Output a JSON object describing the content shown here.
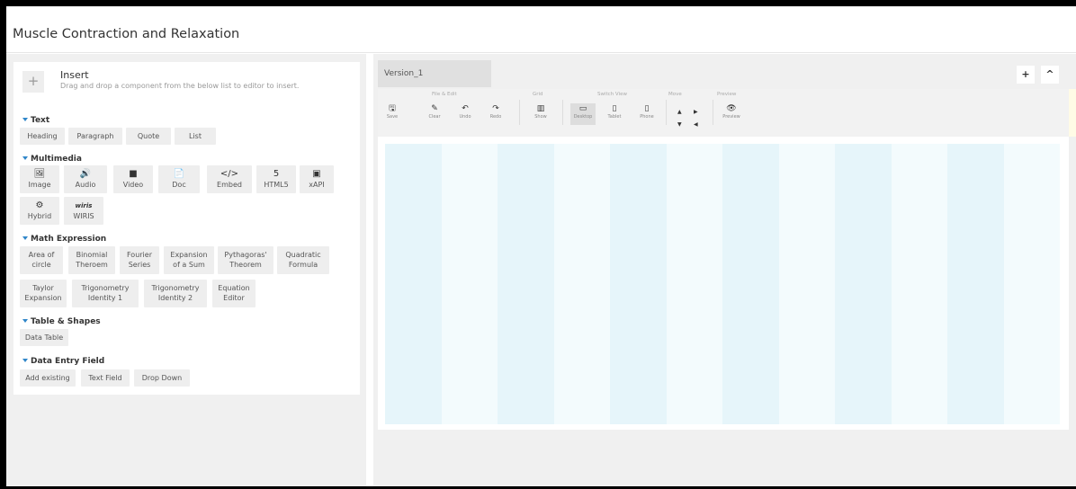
{
  "title": "Muscle Contraction and Relaxation",
  "insert": {
    "plus": "+",
    "title": "Insert",
    "subtitle": "Drag and drop a component from the below list to editor to insert."
  },
  "sections": {
    "text": "Text",
    "multimedia": "Multimedia",
    "math": "Math Expression",
    "table": "Table & Shapes",
    "entry": "Data Entry Field"
  },
  "text_items": [
    "Heading",
    "Paragraph",
    "Quote",
    "List"
  ],
  "media_items": [
    {
      "icon": "🖼",
      "label": "Image"
    },
    {
      "icon": "🔊",
      "label": "Audio"
    },
    {
      "icon": "■",
      "label": "Video"
    },
    {
      "icon": "📄",
      "label": "Doc"
    },
    {
      "icon": "</>",
      "label": "Embed"
    },
    {
      "icon": "5",
      "label": "HTML5"
    },
    {
      "icon": "▣",
      "label": "xAPI"
    },
    {
      "icon": "⚙",
      "label": "Hybrid"
    },
    {
      "icon": "wiris",
      "label": "WIRIS"
    }
  ],
  "math_items": [
    {
      "l1": "Area of",
      "l2": "circle"
    },
    {
      "l1": "Binomial",
      "l2": "Theroem"
    },
    {
      "l1": "Fourier",
      "l2": "Series"
    },
    {
      "l1": "Expansion",
      "l2": "of a Sum"
    },
    {
      "l1": "Pythagoras'",
      "l2": "Theorem"
    },
    {
      "l1": "Quadratic",
      "l2": "Formula"
    },
    {
      "l1": "Taylor",
      "l2": "Expansion"
    },
    {
      "l1": "Trigonometry",
      "l2": "Identity 1"
    },
    {
      "l1": "Trigonometry",
      "l2": "Identity 2"
    },
    {
      "l1": "Equation",
      "l2": "Editor"
    }
  ],
  "table_items": [
    "Data Table"
  ],
  "entry_items": [
    "Add existing",
    "Text Field",
    "Drop Down"
  ],
  "editor": {
    "version_tab": "Version_1",
    "add_btn": "+",
    "collapse_btn": "^"
  },
  "toolbar": {
    "groups": [
      "File & Edit",
      "Grid",
      "Switch View",
      "Move",
      "Preview"
    ],
    "tools": [
      {
        "icon": "🖫",
        "label": "Save"
      },
      {
        "icon": "✎",
        "label": "Clear"
      },
      {
        "icon": "↶",
        "label": "Undo"
      },
      {
        "icon": "↷",
        "label": "Redo"
      },
      {
        "icon": "▥",
        "label": "Show"
      },
      {
        "icon": "▭",
        "label": "Desktop"
      },
      {
        "icon": "▯",
        "label": "Tablet"
      },
      {
        "icon": "▯",
        "label": "Phone"
      },
      {
        "icon": "👁",
        "label": "Preview"
      }
    ],
    "move_up": "▲",
    "move_right": "▶",
    "move_down": "▼",
    "move_left": "◀"
  }
}
